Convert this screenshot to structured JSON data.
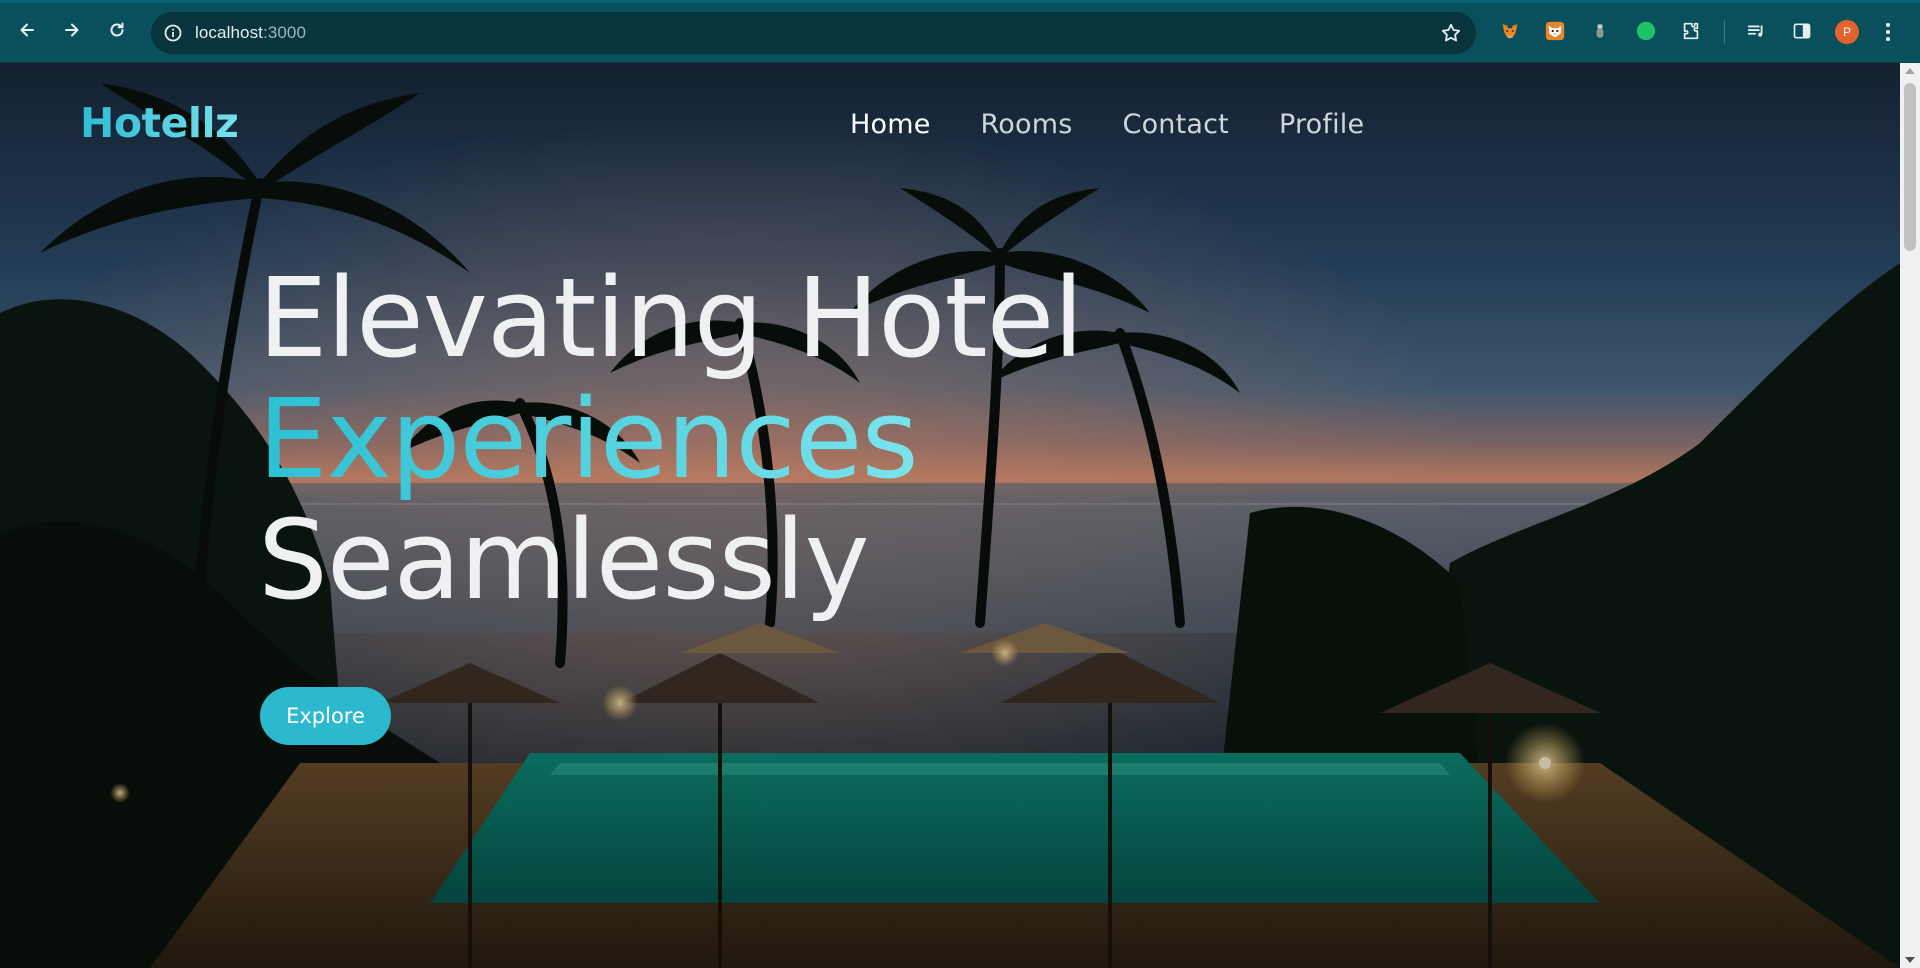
{
  "browser": {
    "url_host": "localhost",
    "url_port": ":3000",
    "profile_initial": "P"
  },
  "site": {
    "logo": "Hotellz",
    "nav": [
      "Home",
      "Rooms",
      "Contact",
      "Profile"
    ],
    "active_nav": "Home",
    "headline_line1": "Elevating Hotel",
    "headline_line2": "Experiences",
    "headline_line3": "Seamlessly",
    "cta_label": "Explore"
  },
  "colors": {
    "chrome_bg": "#0a4f5c",
    "accent": "#2cb8cd"
  },
  "icons": [
    "back-arrow-icon",
    "forward-arrow-icon",
    "reload-icon",
    "site-info-icon",
    "bookmark-star-icon",
    "metamask-fox-icon",
    "fox-extension-icon",
    "grey-extension-icon",
    "green-dot-extension-icon",
    "puzzle-extensions-icon",
    "media-queue-icon",
    "side-panel-icon",
    "kebab-menu-icon"
  ]
}
